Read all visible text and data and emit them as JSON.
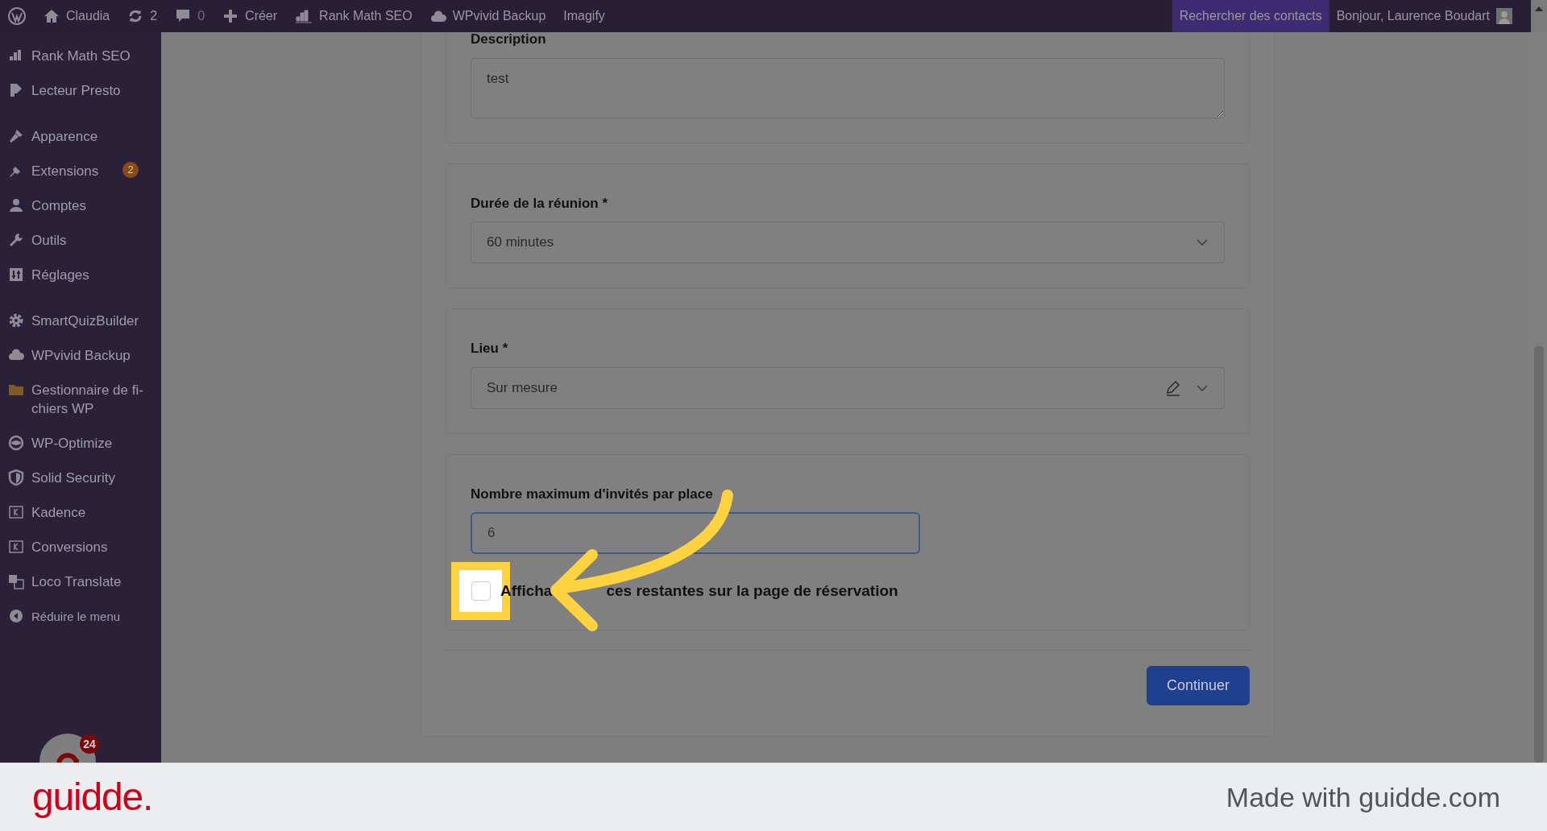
{
  "top_bar": {
    "site": "Claudia",
    "updates": "2",
    "comments": "0",
    "new": "Créer",
    "items": [
      "Rank Math SEO",
      "WPvivid Backup",
      "Imagify"
    ],
    "search_contacts": "Rechercher des contacts",
    "greeting": "Bonjour, Laurence Boudart"
  },
  "sidebar": {
    "groups": [
      {
        "items": [
          {
            "label": "Rank Math SEO",
            "kind": "chart"
          },
          {
            "label": "Lecteur Presto",
            "kind": "play"
          }
        ]
      },
      {
        "items": [
          {
            "label": "Apparence",
            "kind": "brush"
          },
          {
            "label": "Extensions",
            "kind": "plug",
            "badge": "2"
          },
          {
            "label": "Comptes",
            "kind": "user"
          },
          {
            "label": "Outils",
            "kind": "wrench"
          },
          {
            "label": "Réglages",
            "kind": "sliders"
          }
        ]
      },
      {
        "items": [
          {
            "label": "SmartQuizBuilder",
            "kind": "gear"
          },
          {
            "label": "WPvivid Backup",
            "kind": "cloud"
          },
          {
            "label": "Gestionnaire de fi-chiers WP",
            "kind": "folder"
          },
          {
            "label": "WP-Optimize",
            "kind": "eye"
          },
          {
            "label": "Solid Security",
            "kind": "shield"
          },
          {
            "label": "Kadence",
            "kind": "square"
          },
          {
            "label": "Conversions",
            "kind": "square"
          },
          {
            "label": "Loco Translate",
            "kind": "translate"
          },
          {
            "label": "Réduire le menu",
            "kind": "collapse"
          }
        ]
      }
    ],
    "chat_badge": "24"
  },
  "form": {
    "description": {
      "label": "Description",
      "value": "test"
    },
    "duration": {
      "label": "Durée de la réunion *",
      "value": "60 minutes"
    },
    "location": {
      "label": "Lieu *",
      "value": "Sur mesure"
    },
    "max_guests": {
      "label": "Nombre maximum d'invités par place",
      "value": "6"
    },
    "show_remaining": {
      "checked": false,
      "text_start": "Afficha",
      "text_end": "ces restantes sur la page de réservation"
    },
    "continue_button": "Continuer"
  },
  "footer": {
    "brand": "guidde.",
    "note": "Made with guidde.com"
  }
}
